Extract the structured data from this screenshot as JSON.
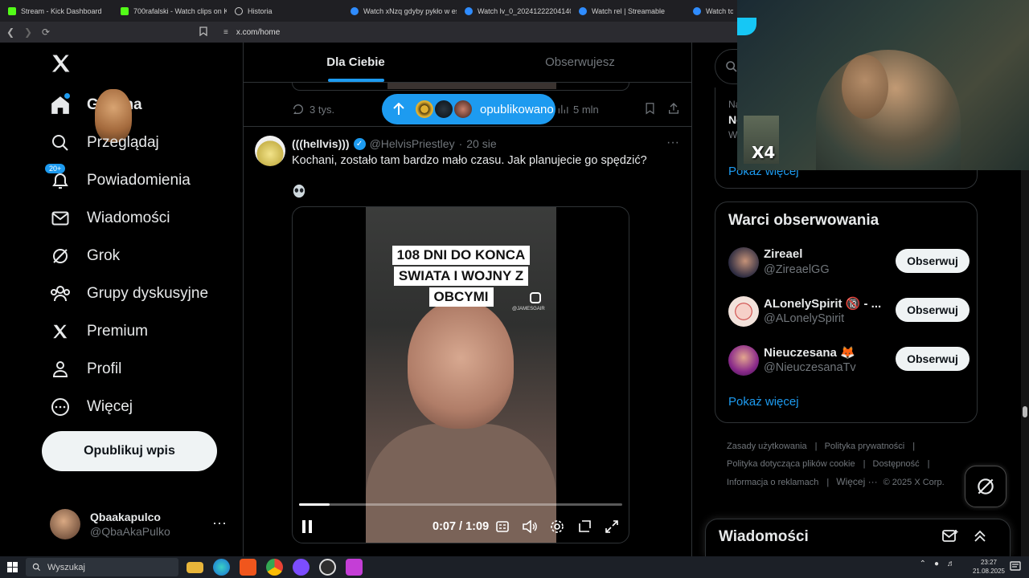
{
  "browser": {
    "tabs": [
      {
        "label": "Stream - Kick Dashboard",
        "icon": "kick-icon"
      },
      {
        "label": "700rafalski - Watch clips on Kic",
        "icon": "kick-icon"
      },
      {
        "label": "Historia",
        "icon": "history-icon"
      },
      {
        "label": "Watch xNzq gdyby pykło w es",
        "icon": "streamable-icon"
      },
      {
        "label": "Watch lv_0_2024122220414023",
        "icon": "streamable-icon"
      },
      {
        "label": "Watch rel | Streamable",
        "icon": "streamable-icon"
      },
      {
        "label": "Watch to j",
        "icon": "streamable-icon"
      }
    ],
    "url": "x.com/home"
  },
  "sidebar": {
    "items": [
      {
        "label": "Główna",
        "icon": "home-icon"
      },
      {
        "label": "Przeglądaj",
        "icon": "search-icon"
      },
      {
        "label": "Powiadomienia",
        "icon": "bell-icon",
        "badge": "20+"
      },
      {
        "label": "Wiadomości",
        "icon": "mail-icon"
      },
      {
        "label": "Grok",
        "icon": "grok-icon"
      },
      {
        "label": "Grupy dyskusyjne",
        "icon": "communities-icon"
      },
      {
        "label": "Premium",
        "icon": "x-icon"
      },
      {
        "label": "Profil",
        "icon": "person-icon"
      },
      {
        "label": "Więcej",
        "icon": "more-circle-icon"
      }
    ],
    "post_button": "Opublikuj wpis",
    "profile": {
      "name": "Qbaakapulco",
      "handle": "@QbaAkaPulko",
      "more": "···"
    }
  },
  "feed": {
    "tabs": [
      "Dla Ciebie",
      "Obserwujesz"
    ],
    "prev_actions": {
      "replies": "3 tys.",
      "views": "5 mln"
    },
    "new_posts_label": "opublikowano",
    "tweet": {
      "name": "(((hellvis)))",
      "handle": "@HelvisPriestley",
      "sep": "·",
      "time": "20 sie",
      "text": "Kochani, zostało tam bardzo mało czasu. Jak planujecie go spędzić?",
      "more": "···",
      "video": {
        "caption_lines": [
          "108 DNI DO KONCA",
          "SWIATA I WOJNY Z",
          "OBCYMI"
        ],
        "watermark": "@JAMESGAIR",
        "time": "0:07 / 1:09",
        "progress": 0.095
      }
    }
  },
  "right": {
    "top_card": {
      "line1": "Na",
      "line2": "No",
      "line3": "W",
      "more": "Pokaż więcej"
    },
    "follow": {
      "title": "Warci obserwowania",
      "follow_label": "Obserwuj",
      "more": "Pokaż więcej",
      "users": [
        {
          "name": "Zireael",
          "handle": "@ZireaelGG"
        },
        {
          "name": "ALonelySpirit 🔞 - ...",
          "handle": "@ALonelySpirit"
        },
        {
          "name": "Nieuczesana 🦊",
          "handle": "@NieuczesanaTv"
        }
      ]
    },
    "footer": {
      "links": [
        "Zasady użytkowania",
        "Polityka prywatności",
        "Polityka dotycząca plików cookie",
        "Dostępność",
        "Informacja o reklamach",
        "Więcej ···"
      ],
      "copyright": "© 2025 X Corp."
    }
  },
  "messages_drawer": {
    "title": "Wiadomości"
  },
  "webcam": {
    "overlay_text": "X4"
  },
  "taskbar": {
    "search_placeholder": "Wyszukaj",
    "time": "23:27",
    "date": "21.08.2025"
  },
  "colors": {
    "accent": "#1d9bf0",
    "bg": "#000000",
    "text": "#e7e9ea",
    "muted": "#71767b"
  }
}
